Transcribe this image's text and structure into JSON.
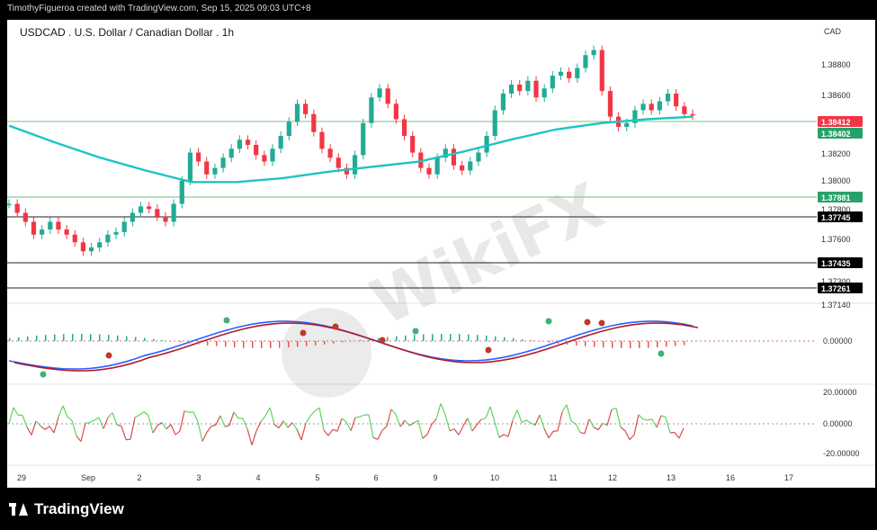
{
  "header": {
    "credit": "TimothyFigueroa created with TradingView.com, Sep 15, 2025 09:03 UTC+8"
  },
  "chart_title": "USDCAD . U.S. Dollar / Canadian Dollar . 1h",
  "currency": "CAD",
  "branding": {
    "name": "TradingView"
  },
  "watermark": {
    "text": "WikiFX"
  },
  "colors": {
    "up": "#22ab94",
    "down": "#f23645",
    "ma": "#1ec3c3",
    "macd": "#2962ff",
    "signal": "#b2182b",
    "osc_up": "#5fd35f",
    "osc_down": "#d94b4b"
  },
  "chart_data": {
    "type": "candlestick",
    "symbol": "USDCAD",
    "timeframe": "1h",
    "x_ticks": [
      "29",
      "Sep",
      "2",
      "3",
      "4",
      "5",
      "6",
      "9",
      "10",
      "11",
      "12",
      "13",
      "16",
      "17"
    ],
    "price_axis": {
      "ticks": [
        "1.38800",
        "1.38600",
        "1.38200",
        "1.38000",
        "1.37800",
        "1.37600",
        "1.37300",
        "1.37140"
      ],
      "range": [
        1.3705,
        1.3898
      ]
    },
    "price_levels": [
      {
        "value": "1.38412",
        "kind": "current",
        "color": "#f23645"
      },
      {
        "value": "1.38402",
        "kind": "moving-average",
        "color": "#26a269"
      },
      {
        "value": "1.37881",
        "kind": "support",
        "color": "#26a269"
      },
      {
        "value": "1.37745",
        "kind": "support",
        "color": "#000000"
      },
      {
        "value": "1.37435",
        "kind": "support",
        "color": "#000000"
      },
      {
        "value": "1.37261",
        "kind": "support",
        "color": "#000000"
      }
    ],
    "close_path": [
      1.3772,
      1.3765,
      1.3758,
      1.3748,
      1.3752,
      1.3758,
      1.3752,
      1.3748,
      1.3742,
      1.3735,
      1.3738,
      1.3742,
      1.3748,
      1.375,
      1.3758,
      1.3765,
      1.377,
      1.3768,
      1.3762,
      1.3758,
      1.3772,
      1.379,
      1.3812,
      1.3805,
      1.3795,
      1.38,
      1.3808,
      1.3815,
      1.3822,
      1.3818,
      1.381,
      1.3805,
      1.3815,
      1.3825,
      1.3836,
      1.385,
      1.3842,
      1.3828,
      1.3815,
      1.3808,
      1.38,
      1.3795,
      1.381,
      1.3835,
      1.3855,
      1.3862,
      1.385,
      1.3838,
      1.3825,
      1.3812,
      1.38,
      1.3795,
      1.3808,
      1.3815,
      1.3802,
      1.3798,
      1.3805,
      1.3812,
      1.3825,
      1.3845,
      1.3858,
      1.3865,
      1.386,
      1.3868,
      1.3855,
      1.3862,
      1.3872,
      1.3875,
      1.387,
      1.3878,
      1.3888,
      1.3892,
      1.386,
      1.384,
      1.3832,
      1.3835,
      1.3845,
      1.385,
      1.3845,
      1.3852,
      1.3858,
      1.3848,
      1.3842,
      1.3841
    ],
    "ma": {
      "values": [
        1.3833,
        1.382,
        1.3808,
        1.3798,
        1.3789,
        1.3789,
        1.3792,
        1.3797,
        1.3801,
        1.3805,
        1.3813,
        1.3822,
        1.383,
        1.3835,
        1.3838,
        1.384
      ]
    },
    "macd": {
      "zero_label": "0.00000"
    },
    "oscillator": {
      "ticks": [
        "20.00000",
        "0.00000",
        "-20.00000"
      ]
    }
  }
}
